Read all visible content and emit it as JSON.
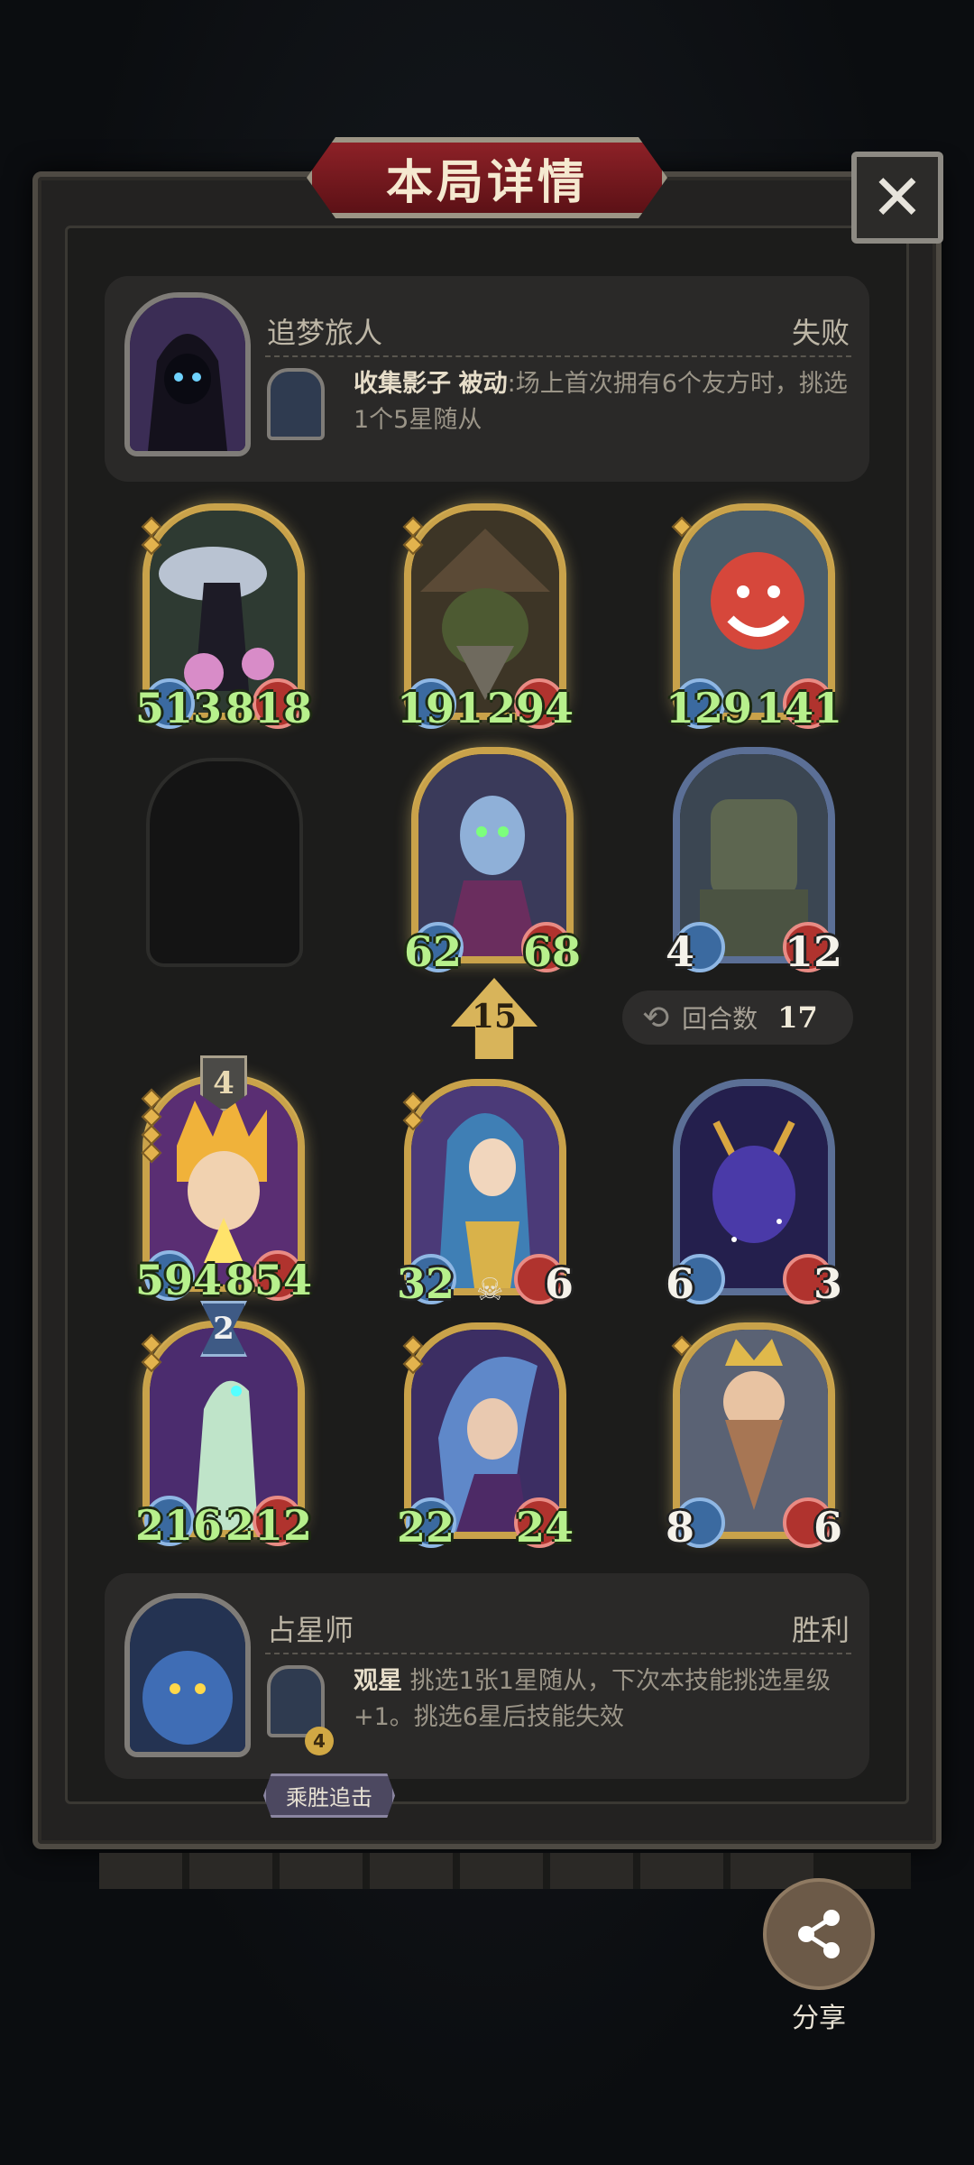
{
  "title": "本局详情",
  "close_label": "✕",
  "top_player": {
    "name": "追梦旅人",
    "result": "失败",
    "skill_name": "收集影子",
    "skill_type": "被动",
    "skill_desc": ":场上首次拥有6个友方时，挑选1个5星随从"
  },
  "bottom_player": {
    "name": "占星师",
    "result": "胜利",
    "skill_name": "观星",
    "skill_desc": "挑选1张1星随从，下次本技能挑选星级+1。挑选6星后技能失效",
    "skill_level": "4",
    "tag": "乘胜追击"
  },
  "enemy_cards": [
    {
      "atk": "513",
      "hp": "818"
    },
    {
      "atk": "191",
      "hp": "294"
    },
    {
      "atk": "129",
      "hp": "141"
    },
    {
      "atk": "62",
      "hp": "68"
    },
    {
      "atk": "4",
      "hp": "12"
    }
  ],
  "turn": {
    "level": "15",
    "rounds_label": "回合数",
    "rounds_value": "17"
  },
  "player_cards": [
    {
      "atk": "594",
      "hp": "854",
      "tier": "4"
    },
    {
      "atk": "32",
      "hp": "6"
    },
    {
      "atk": "6",
      "hp": "3"
    },
    {
      "atk": "216",
      "hp": "212",
      "tier": "2"
    },
    {
      "atk": "22",
      "hp": "24"
    },
    {
      "atk": "8",
      "hp": "6"
    }
  ],
  "share_label": "分享",
  "colors": {
    "gold_frame": "#c9a24a",
    "stat_green": "#b7f08c",
    "title_red": "#8d2127"
  }
}
